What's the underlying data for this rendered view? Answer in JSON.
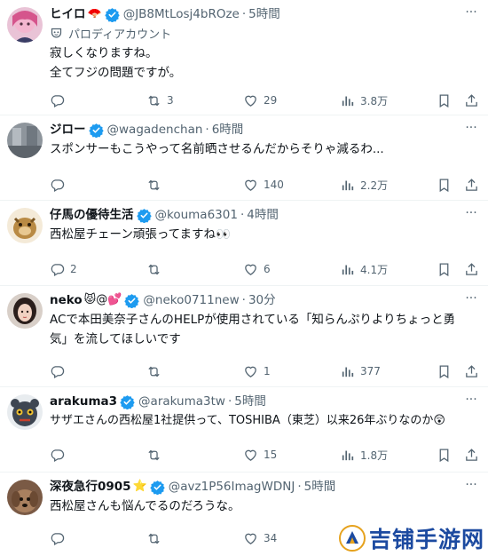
{
  "colors": {
    "verified": "#1d9bf0",
    "muted": "#536471",
    "text": "#0f1419",
    "divider": "#eff3f4",
    "watermark": "#1c4aa0"
  },
  "icons": {
    "reply": "reply-icon",
    "retweet": "retweet-icon",
    "like": "heart-icon",
    "views": "views-icon",
    "bookmark": "bookmark-icon",
    "share": "share-icon",
    "more": "more-icon",
    "verified": "verified-badge-icon"
  },
  "tweets": [
    {
      "name": "ヒイロ",
      "name_emoji": "🪭",
      "handle": "@JB8MtLosj4bROze",
      "time": "5時間",
      "parody_label": "パロディアカウント",
      "text": "寂しくなりますね。\n全てフジの問題ですが。",
      "replies": "",
      "retweets": "3",
      "likes": "29",
      "views": "3.8万"
    },
    {
      "name": "ジロー",
      "name_emoji": "",
      "handle": "@wagadenchan",
      "time": "6時間",
      "text": "スポンサーもこうやって名前晒させるんだからそりゃ減るわ...",
      "replies": "",
      "retweets": "",
      "likes": "140",
      "views": "2.2万"
    },
    {
      "name": "仔馬の優待生活",
      "name_emoji": "",
      "handle": "@kouma6301",
      "time": "4時間",
      "text": "西松屋チェーン頑張ってますね👀",
      "replies": "2",
      "retweets": "",
      "likes": "6",
      "views": "4.1万"
    },
    {
      "name": "neko",
      "name_emoji": "😾@💕",
      "handle": "@neko0711new",
      "time": "30分",
      "text": "ACで本田美奈子さんのHELPが使用されている「知らんぷりよりちょっと勇気」を流してほしいです",
      "replies": "",
      "retweets": "",
      "likes": "1",
      "views": "377"
    },
    {
      "name": "arakuma3",
      "name_emoji": "",
      "handle": "@arakuma3tw",
      "time": "5時間",
      "text": "サザエさんの西松屋1社提供って、TOSHIBA（東芝）以来26年ぶりなのか😲",
      "replies": "",
      "retweets": "",
      "likes": "15",
      "views": "1.8万"
    },
    {
      "name": "深夜急行0905",
      "name_emoji": "⭐",
      "handle": "@avz1P56ImagWDNJ",
      "time": "5時間",
      "text": "西松屋さんも悩んでるのだろうな。",
      "replies": "",
      "retweets": "",
      "likes": "34",
      "views": ""
    }
  ],
  "watermark": {
    "text": "吉铺手游网"
  }
}
